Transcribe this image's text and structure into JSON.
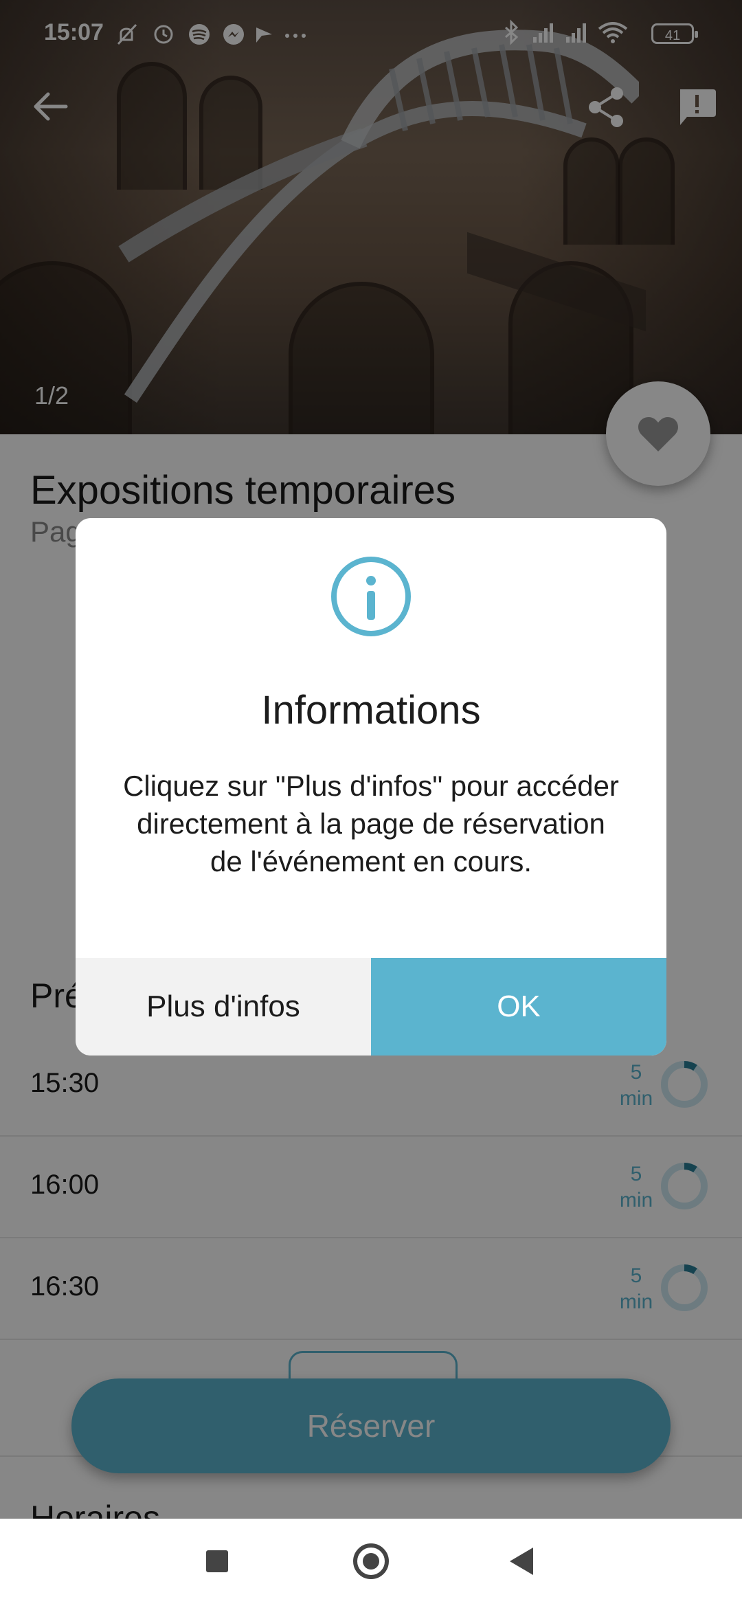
{
  "status_bar": {
    "time": "15:07",
    "battery": "41"
  },
  "gallery": {
    "counter": "1/2"
  },
  "event": {
    "title": "Expositions temporaires",
    "subtitle": "Pag",
    "sessions_heading": "Pré",
    "sessions": [
      {
        "time": "15:30",
        "duration_value": "5",
        "duration_unit": "min"
      },
      {
        "time": "16:00",
        "duration_value": "5",
        "duration_unit": "min"
      },
      {
        "time": "16:30",
        "duration_value": "5",
        "duration_unit": "min"
      }
    ],
    "reserve_label": "Réserver",
    "hours_heading": "Horaires"
  },
  "dialog": {
    "title": "Informations",
    "message": "Cliquez sur \"Plus d'infos\" pour accéder directement à la page de réservation de l'événement en cours.",
    "more_label": "Plus d'infos",
    "ok_label": "OK"
  },
  "colors": {
    "accent": "#5bb4cf",
    "text": "#1c1c1c"
  }
}
